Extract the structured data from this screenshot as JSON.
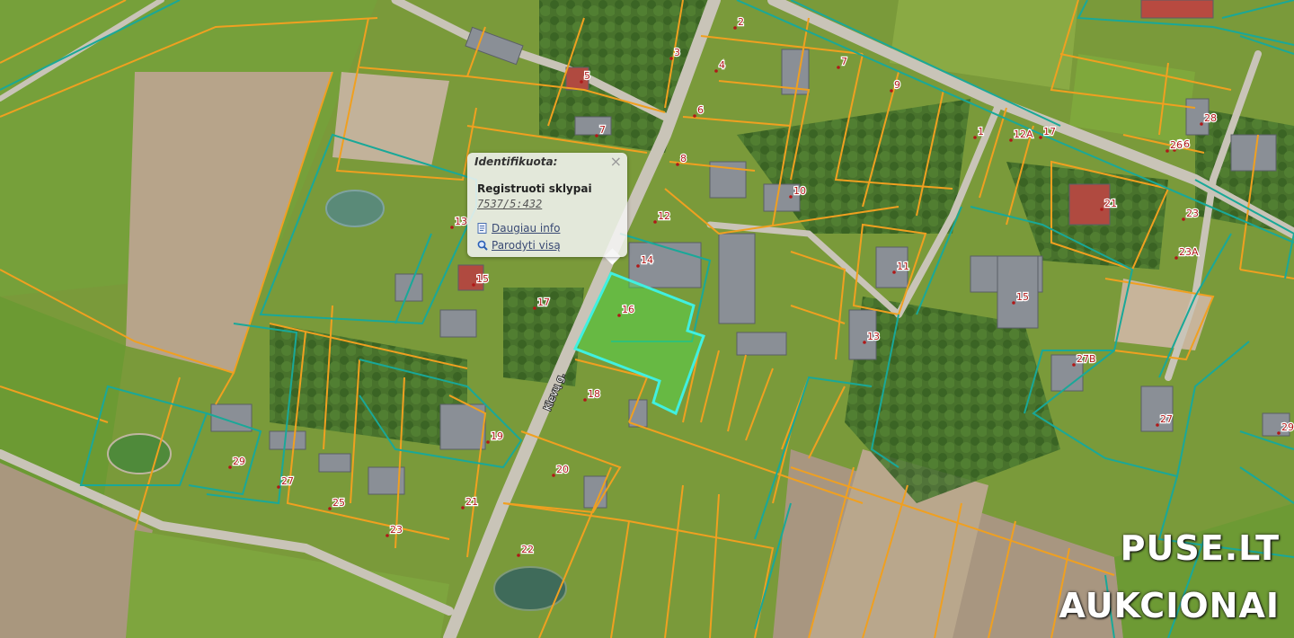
{
  "colors": {
    "field": "#6f8f2e",
    "parcel_orange": "#f0a020",
    "parcel_teal": "#19a898",
    "selected_fill": "#4fe04f",
    "selected_stroke": "#40f0e0",
    "house_label": "#b01818"
  },
  "popup": {
    "title": "Identifikuota:",
    "close": "×",
    "layer": "Registruoti sklypai",
    "parcel_id": "7537/5:432",
    "more_info": "Daugiau info",
    "show_all": "Parodyti visą",
    "more_info_icon": "document-icon",
    "show_all_icon": "magnifier-icon"
  },
  "street_name": "Klevų g.",
  "house_numbers": [
    "2",
    "3",
    "4",
    "5",
    "6",
    "7",
    "7",
    "8",
    "9",
    "10",
    "11",
    "12",
    "13",
    "13",
    "14",
    "15",
    "15",
    "16",
    "17",
    "18",
    "19",
    "20",
    "21",
    "21",
    "22",
    "23",
    "25",
    "26",
    "27",
    "27",
    "27B",
    "28",
    "29",
    "29",
    "12A",
    "23",
    "23A",
    "1",
    "17",
    "26"
  ],
  "watermark": {
    "line1": "PUSE.LT",
    "line2": "AUKCIONAI"
  }
}
